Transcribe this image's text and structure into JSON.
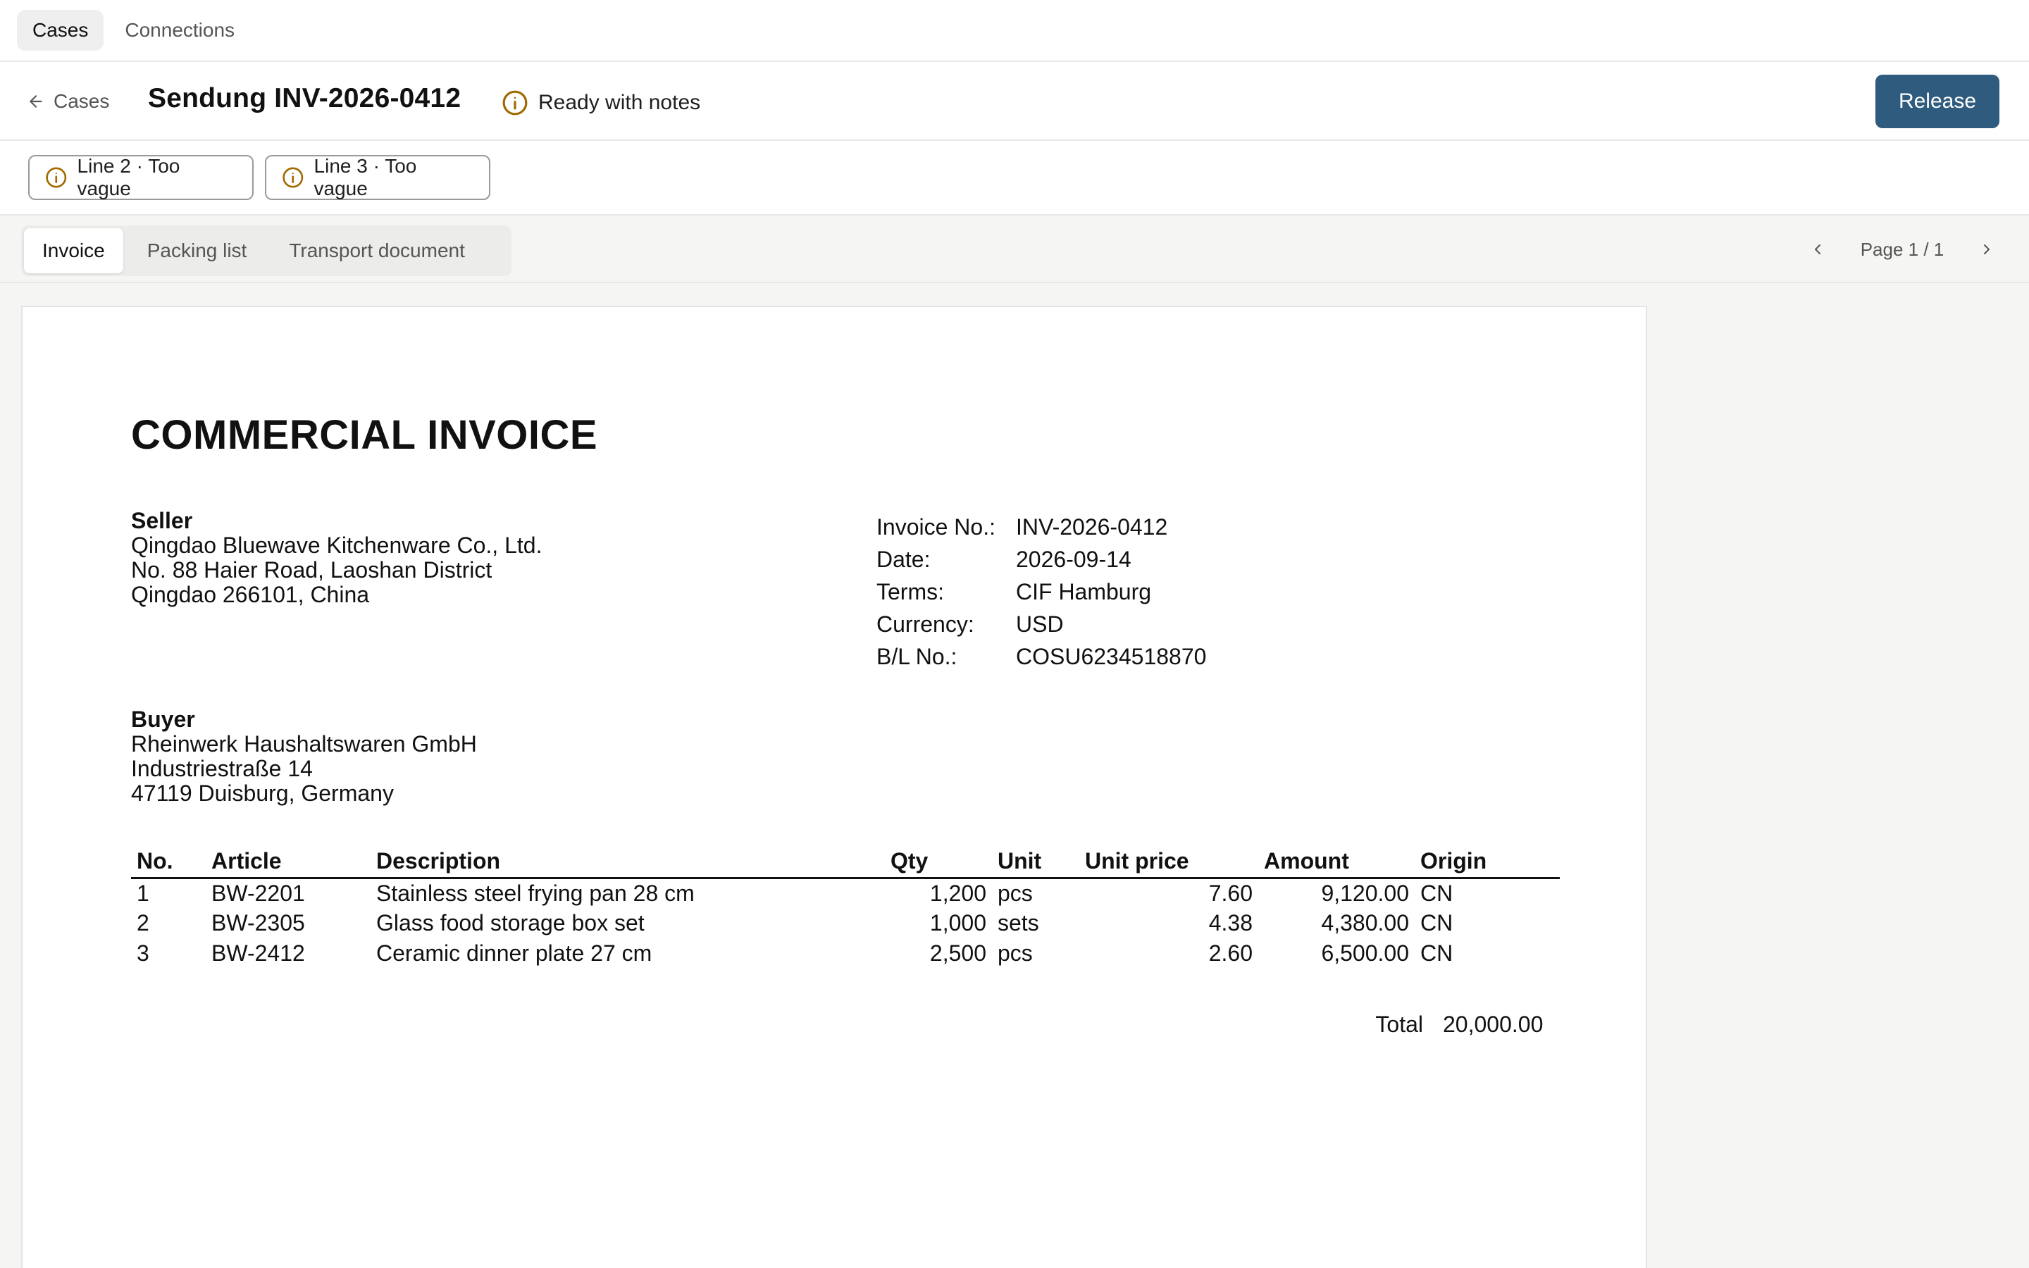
{
  "nav": {
    "tabs": [
      {
        "label": "Cases",
        "active": true
      },
      {
        "label": "Connections",
        "active": false
      }
    ]
  },
  "header": {
    "back_label": "Cases",
    "title": "Sendung INV-2026-0412",
    "status": "Ready with notes",
    "status_icon": "info-circle-icon",
    "release_label": "Release"
  },
  "issues": [
    {
      "label": "Line 2 · Too vague",
      "icon": "info-circle-icon"
    },
    {
      "label": "Line 3 · Too vague",
      "icon": "info-circle-icon"
    }
  ],
  "doc_tabs": [
    {
      "label": "Invoice",
      "active": true
    },
    {
      "label": "Packing list",
      "active": false
    },
    {
      "label": "Transport document",
      "active": false
    }
  ],
  "pager": {
    "label": "Page 1 / 1"
  },
  "invoice": {
    "title": "COMMERCIAL INVOICE",
    "seller": {
      "label": "Seller",
      "lines": [
        "Qingdao Bluewave Kitchenware Co., Ltd.",
        "No. 88 Haier Road, Laoshan District",
        "Qingdao 266101, China"
      ]
    },
    "buyer": {
      "label": "Buyer",
      "lines": [
        "Rheinwerk Haushaltswaren GmbH",
        "Industriestraße 14",
        "47119 Duisburg, Germany"
      ]
    },
    "meta": [
      {
        "key": "Invoice No.:",
        "value": "INV-2026-0412"
      },
      {
        "key": "Date:",
        "value": "2026-09-14"
      },
      {
        "key": "Terms:",
        "value": "CIF Hamburg"
      },
      {
        "key": "Currency:",
        "value": "USD"
      },
      {
        "key": "B/L No.:",
        "value": "COSU6234518870"
      }
    ],
    "columns": [
      "No.",
      "Article",
      "Description",
      "Qty",
      "Unit",
      "Unit price",
      "Amount",
      "Origin"
    ],
    "rows": [
      [
        "1",
        "BW-2201",
        "Stainless steel frying pan 28 cm",
        "1,200",
        "pcs",
        "7.60",
        "9,120.00",
        "CN"
      ],
      [
        "2",
        "BW-2305",
        "Glass food storage box set",
        "1,000",
        "sets",
        "4.38",
        "4,380.00",
        "CN"
      ],
      [
        "3",
        "BW-2412",
        "Ceramic dinner plate 27 cm",
        "2,500",
        "pcs",
        "2.60",
        "6,500.00",
        "CN"
      ]
    ],
    "total_label": "Total",
    "total_value": "20,000.00"
  },
  "colors": {
    "accent": "#2e5b7e",
    "warning_icon": "#a06a00"
  }
}
